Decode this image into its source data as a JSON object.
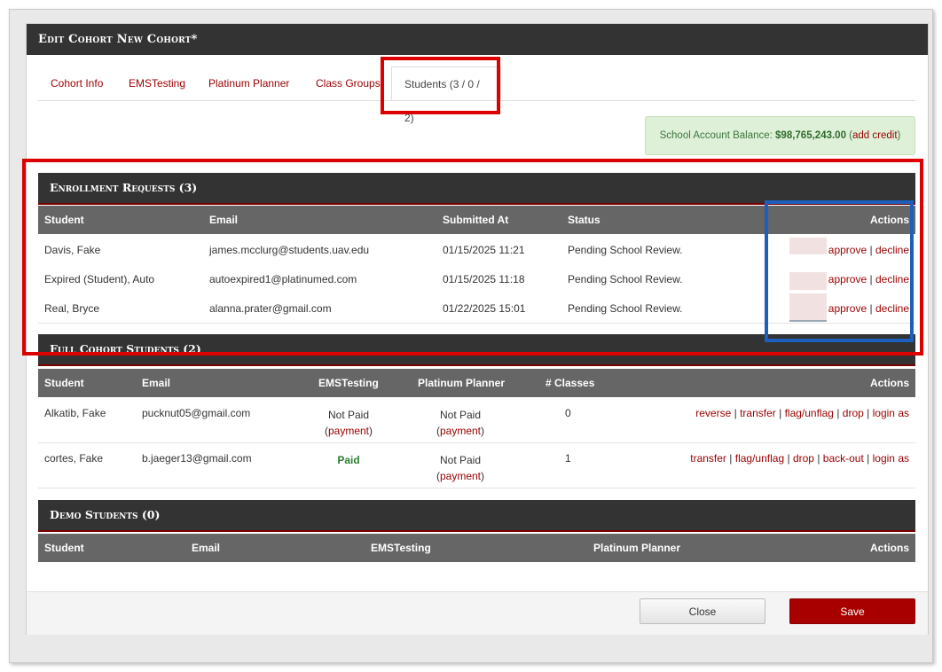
{
  "dialog": {
    "title": "Edit Cohort New Cohort*"
  },
  "tabs": [
    {
      "label": "Cohort Info"
    },
    {
      "label": "EMSTesting"
    },
    {
      "label": "Platinum Planner"
    },
    {
      "label": "Class Groups"
    },
    {
      "label": "Students (3 / 0 / 2)"
    }
  ],
  "balance": {
    "prefix": "School Account Balance: ",
    "amount": "$98,765,243.00",
    "open": " (",
    "link": "add credit",
    "close": ")"
  },
  "enrollment": {
    "title": "Enrollment Requests (3)",
    "headers": {
      "student": "Student",
      "email": "Email",
      "submitted": "Submitted At",
      "status": "Status",
      "actions": "Actions"
    },
    "rows": [
      {
        "student": "Davis, Fake",
        "email": "james.mcclurg@students.uav.edu",
        "submitted": "01/15/2025 11:21",
        "status": "Pending School Review.",
        "approve": "approve",
        "decline": "decline"
      },
      {
        "student": "Expired (Student), Auto",
        "email": "autoexpired1@platinumed.com",
        "submitted": "01/15/2025 11:18",
        "status": "Pending School Review.",
        "approve": "approve",
        "decline": "decline"
      },
      {
        "student": "Real, Bryce",
        "email": "alanna.prater@gmail.com",
        "submitted": "01/22/2025 15:01",
        "status": "Pending School Review.",
        "approve": "approve",
        "decline": "decline"
      }
    ]
  },
  "full": {
    "title": "Full Cohort Students (2)",
    "headers": {
      "student": "Student",
      "email": "Email",
      "ems": "EMSTesting",
      "planner": "Platinum Planner",
      "classes": "# Classes",
      "actions": "Actions"
    },
    "rows": [
      {
        "student": "Alkatib, Fake",
        "email": "pucknut05@gmail.com",
        "ems": "Not Paid",
        "ems_link": "payment",
        "planner": "Not Paid",
        "planner_link": "payment",
        "classes": "0",
        "actions": [
          "reverse",
          "transfer",
          "flag/unflag",
          "drop",
          "login as"
        ]
      },
      {
        "student": "cortes, Fake",
        "email": "b.jaeger13@gmail.com",
        "ems": "Paid",
        "ems_link": "",
        "planner": "Not Paid",
        "planner_link": "payment",
        "classes": "1",
        "actions": [
          "transfer",
          "flag/unflag",
          "drop",
          "back-out",
          "login as"
        ]
      }
    ]
  },
  "demo": {
    "title": "Demo Students (0)",
    "headers": {
      "student": "Student",
      "email": "Email",
      "ems": "EMSTesting",
      "planner": "Platinum Planner",
      "actions": "Actions"
    }
  },
  "footer": {
    "close": "Close",
    "save": "Save"
  },
  "colors": {
    "header": "#333333",
    "subheader": "#666666",
    "link": "#990000",
    "save": "#a80000",
    "highlight_red": "#dd0000",
    "highlight_blue": "#1c5fbd"
  }
}
